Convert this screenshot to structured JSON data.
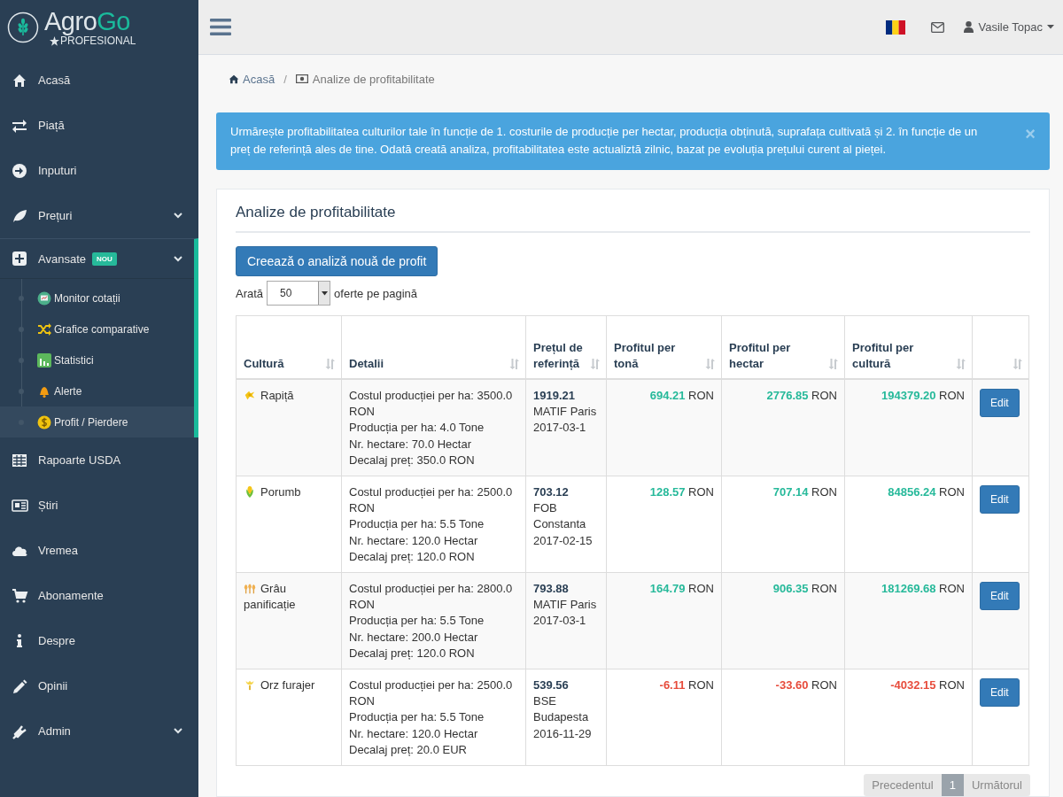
{
  "sidebar": {
    "logo": {
      "first": "Agro",
      "second": "Go",
      "tagline": "PROFESIONAL"
    },
    "items": [
      {
        "label": "Acasă"
      },
      {
        "label": "Piață"
      },
      {
        "label": "Inputuri"
      },
      {
        "label": "Prețuri",
        "expanded": false
      },
      {
        "label": "Avansate",
        "badge": "NOU",
        "expanded": true,
        "children": [
          {
            "label": "Monitor cotații",
            "selected": false
          },
          {
            "label": "Grafice comparative",
            "selected": false
          },
          {
            "label": "Statistici",
            "selected": false
          },
          {
            "label": "Alerte",
            "selected": false
          },
          {
            "label": "Profit / Pierdere",
            "selected": true
          }
        ]
      },
      {
        "label": "Rapoarte USDA"
      },
      {
        "label": "Știri"
      },
      {
        "label": "Vremea"
      },
      {
        "label": "Abonamente"
      },
      {
        "label": "Despre"
      },
      {
        "label": "Opinii"
      },
      {
        "label": "Admin",
        "expanded": false
      }
    ]
  },
  "topbar": {
    "user": "Vasile Topac"
  },
  "breadcrumb": {
    "separator": "/",
    "items": [
      {
        "label": "Acasă"
      },
      {
        "label": "Analize de profitabilitate"
      }
    ]
  },
  "alert": {
    "text": "Urmărește profitabilitatea culturilor tale în funcție de 1. costurile de producție per hectar, producția obținută, suprafața cultivată și 2. în funcție de un preț de referință ales de tine. Odată creată analiza, profitabilitatea este actualiztă zilnic, bazat pe evoluția prețului curent al pieței.",
    "close": "×"
  },
  "panel": {
    "title": "Analize de profitabilitate",
    "create_button": "Creează o analiză nouă de profit",
    "page_size": {
      "prefix": "Arată",
      "value": "50",
      "suffix": "oferte pe pagină"
    }
  },
  "table": {
    "columns": [
      "Cultură",
      "Detalii",
      "Prețul de referință",
      "Profitul per tonă",
      "Profitul per hectar",
      "Profitul per cultură"
    ],
    "rows": [
      {
        "crop": "Rapiță",
        "details": [
          "Costul producției per ha: 3500.0 RON",
          "Producția per ha: 4.0 Tone",
          "Nr. hectare: 70.0 Hectar",
          "Decalaj preț: 350.0 RON"
        ],
        "reference": {
          "price": "1919.21",
          "market": "MATIF Paris",
          "date": "2017-03-1"
        },
        "profits": [
          {
            "value": "694.21",
            "unit": "RON",
            "negative": false
          },
          {
            "value": "2776.85",
            "unit": "RON",
            "negative": false
          },
          {
            "value": "194379.20",
            "unit": "RON",
            "negative": false
          }
        ],
        "action": "Edit"
      },
      {
        "crop": "Porumb",
        "details": [
          "Costul producției per ha: 2500.0 RON",
          "Producția per ha: 5.5 Tone",
          "Nr. hectare: 120.0 Hectar",
          "Decalaj preț: 120.0 RON"
        ],
        "reference": {
          "price": "703.12",
          "market": "FOB Constanta",
          "date": "2017-02-15"
        },
        "profits": [
          {
            "value": "128.57",
            "unit": "RON",
            "negative": false
          },
          {
            "value": "707.14",
            "unit": "RON",
            "negative": false
          },
          {
            "value": "84856.24",
            "unit": "RON",
            "negative": false
          }
        ],
        "action": "Edit"
      },
      {
        "crop": "Grâu panificație",
        "details": [
          "Costul producției per ha: 2800.0 RON",
          "Producția per ha: 5.5 Tone",
          "Nr. hectare: 200.0 Hectar",
          "Decalaj preț: 120.0 RON"
        ],
        "reference": {
          "price": "793.88",
          "market": "MATIF Paris",
          "date": "2017-03-1"
        },
        "profits": [
          {
            "value": "164.79",
            "unit": "RON",
            "negative": false
          },
          {
            "value": "906.35",
            "unit": "RON",
            "negative": false
          },
          {
            "value": "181269.68",
            "unit": "RON",
            "negative": false
          }
        ],
        "action": "Edit"
      },
      {
        "crop": "Orz furajer",
        "details": [
          "Costul producției per ha: 2500.0 RON",
          "Producția per ha: 5.5 Tone",
          "Nr. hectare: 120.0 Hectar",
          "Decalaj preț: 20.0 EUR"
        ],
        "reference": {
          "price": "539.56",
          "market": "BSE Budapesta",
          "date": "2016-11-29"
        },
        "profits": [
          {
            "value": "-6.11",
            "unit": "RON",
            "negative": true
          },
          {
            "value": "-33.60",
            "unit": "RON",
            "negative": true
          },
          {
            "value": "-4032.15",
            "unit": "RON",
            "negative": true
          }
        ],
        "action": "Edit"
      }
    ]
  },
  "pagination": {
    "previous": "Precedentul",
    "pages": [
      {
        "label": "1",
        "selected": true
      }
    ],
    "next": "Următorul"
  }
}
